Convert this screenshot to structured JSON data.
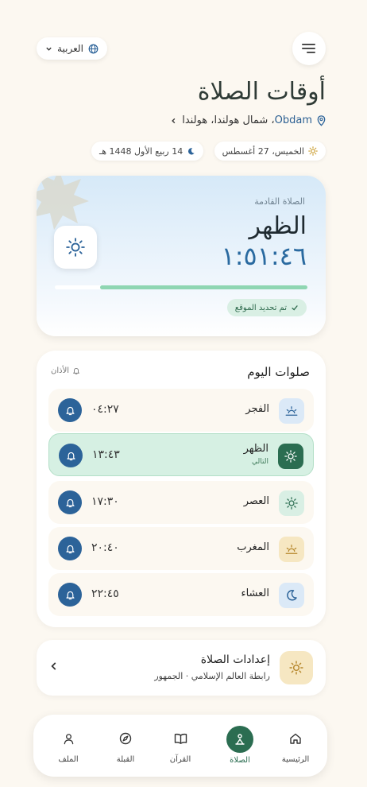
{
  "header": {
    "language_label": "العربية",
    "page_title": "أوقات الصلاة",
    "location_city": "Obdam",
    "location_region": "، شمال هولندا، هولندا",
    "gregorian_date": "الخميس، 27 أغسطس",
    "hijri_date": "14 ربيع الأول 1448 هـ"
  },
  "next_prayer": {
    "label": "الصلاة القادمة",
    "name": "الظهر",
    "countdown": "١:٥١:٤٦",
    "progress_percent": 82,
    "location_status": "تم تحديد الموقع"
  },
  "prayers": {
    "title": "صلوات اليوم",
    "adhan_label": "الأذان",
    "items": [
      {
        "name": "الفجر",
        "time": "٠٤:٢٧",
        "sub": "",
        "icon": "sunrise-icon",
        "icon_bg": "#dbe9f7"
      },
      {
        "name": "الظهر",
        "time": "١٣:٤٣",
        "sub": "التالي",
        "icon": "sun-icon",
        "icon_bg": "#2b6d51"
      },
      {
        "name": "العصر",
        "time": "١٧:٣٠",
        "sub": "",
        "icon": "sun-icon",
        "icon_bg": "#d9efe4"
      },
      {
        "name": "المغرب",
        "time": "٢٠:٤٠",
        "sub": "",
        "icon": "sunset-icon",
        "icon_bg": "#f6e7c2"
      },
      {
        "name": "العشاء",
        "time": "٢٢:٤٥",
        "sub": "",
        "icon": "moon-icon",
        "icon_bg": "#dbe9f7"
      }
    ]
  },
  "settings": {
    "title": "إعدادات الصلاة",
    "subtitle": "رابطة العالم الإسلامي · الجمهور"
  },
  "nav": {
    "home": "الرئيسية",
    "prayer": "الصلاة",
    "quran": "القرآن",
    "qibla": "القبلة",
    "profile": "الملف"
  },
  "colors": {
    "accent_green": "#2b6d51",
    "accent_blue": "#2c6399",
    "background": "#fcf8f1"
  }
}
